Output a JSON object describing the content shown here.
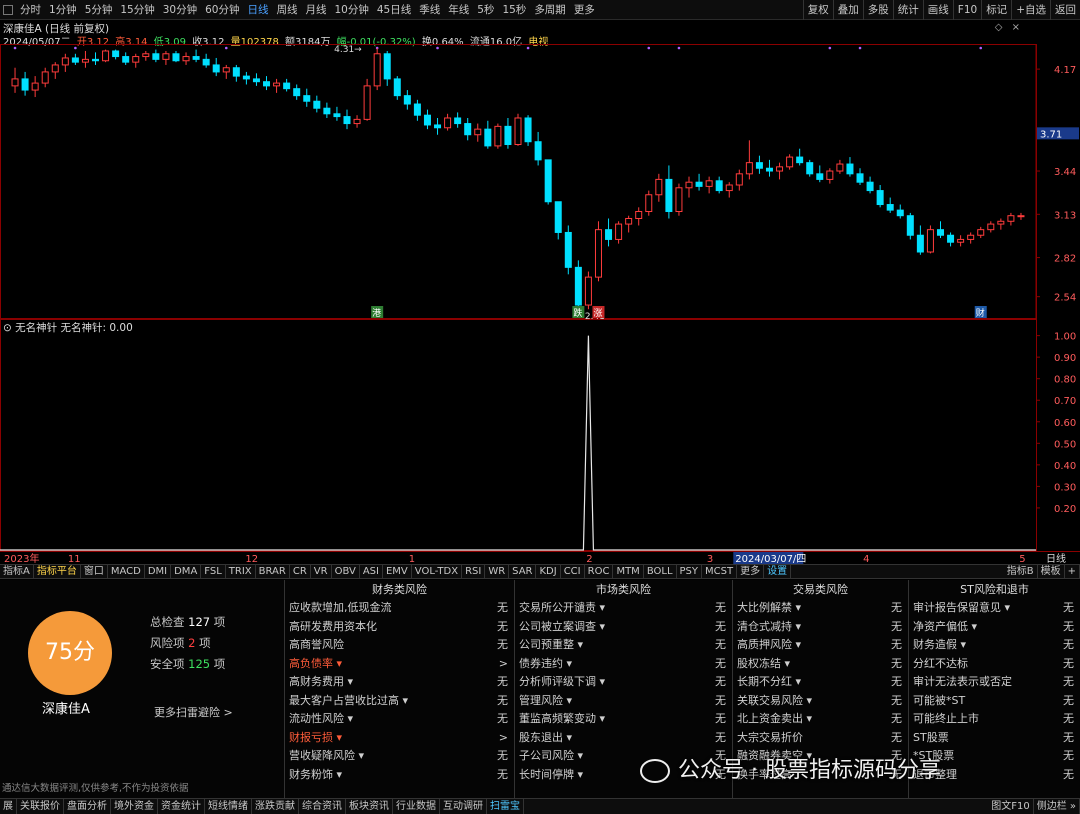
{
  "toolbar": {
    "left": [
      "分时",
      "1分钟",
      "5分钟",
      "15分钟",
      "30分钟",
      "60分钟",
      "日线",
      "周线",
      "月线",
      "10分钟",
      "45日线",
      "季线",
      "年线",
      "5秒",
      "15秒",
      "多周期",
      "更多"
    ],
    "selected": "日线",
    "right": [
      "复权",
      "叠加",
      "多股",
      "统计",
      "画线",
      "F10",
      "标记",
      "+自选",
      "返回"
    ]
  },
  "header": {
    "title": "深康佳A (日线 前复权)",
    "date": "2024/05/07二",
    "open": "开3.12",
    "high": "高3.14",
    "low": "低3.09",
    "close": "收3.12",
    "volume": "量102378",
    "amount": "额3184万",
    "change": "幅-0.01(-0.32%)",
    "turnover": "换0.64%",
    "float": "流通16.0亿",
    "tv": "电视",
    "high_mark": "4.31",
    "low_mark": "2.41"
  },
  "chart_data": [
    {
      "type": "candlestick",
      "y_ticks": [
        4.17,
        3.71,
        3.44,
        3.13,
        2.82,
        2.54
      ],
      "current_price": "3.71",
      "ylim": [
        2.38,
        4.35
      ],
      "candles": [
        [
          4.05,
          4.18,
          4.0,
          4.1
        ],
        [
          4.1,
          4.15,
          3.98,
          4.02
        ],
        [
          4.02,
          4.12,
          3.97,
          4.07
        ],
        [
          4.07,
          4.18,
          4.04,
          4.15
        ],
        [
          4.15,
          4.22,
          4.1,
          4.2
        ],
        [
          4.2,
          4.28,
          4.15,
          4.25
        ],
        [
          4.25,
          4.28,
          4.2,
          4.22
        ],
        [
          4.22,
          4.3,
          4.18,
          4.24
        ],
        [
          4.24,
          4.29,
          4.2,
          4.23
        ],
        [
          4.23,
          4.31,
          4.22,
          4.3
        ],
        [
          4.3,
          4.31,
          4.24,
          4.26
        ],
        [
          4.26,
          4.29,
          4.2,
          4.22
        ],
        [
          4.22,
          4.28,
          4.18,
          4.26
        ],
        [
          4.26,
          4.3,
          4.23,
          4.28
        ],
        [
          4.28,
          4.31,
          4.22,
          4.24
        ],
        [
          4.24,
          4.3,
          4.2,
          4.28
        ],
        [
          4.28,
          4.3,
          4.22,
          4.23
        ],
        [
          4.23,
          4.29,
          4.2,
          4.26
        ],
        [
          4.26,
          4.31,
          4.22,
          4.24
        ],
        [
          4.24,
          4.28,
          4.18,
          4.2
        ],
        [
          4.2,
          4.25,
          4.12,
          4.15
        ],
        [
          4.15,
          4.2,
          4.1,
          4.18
        ],
        [
          4.18,
          4.2,
          4.08,
          4.12
        ],
        [
          4.12,
          4.15,
          4.06,
          4.1
        ],
        [
          4.1,
          4.14,
          4.05,
          4.08
        ],
        [
          4.08,
          4.12,
          4.02,
          4.05
        ],
        [
          4.05,
          4.1,
          4.0,
          4.07
        ],
        [
          4.07,
          4.1,
          4.01,
          4.03
        ],
        [
          4.03,
          4.06,
          3.95,
          3.98
        ],
        [
          3.98,
          4.03,
          3.9,
          3.94
        ],
        [
          3.94,
          3.98,
          3.86,
          3.89
        ],
        [
          3.89,
          3.93,
          3.82,
          3.85
        ],
        [
          3.85,
          3.9,
          3.8,
          3.83
        ],
        [
          3.83,
          3.88,
          3.74,
          3.78
        ],
        [
          3.78,
          3.84,
          3.75,
          3.81
        ],
        [
          3.81,
          4.1,
          3.8,
          4.05
        ],
        [
          4.05,
          4.32,
          4.02,
          4.28
        ],
        [
          4.28,
          4.3,
          4.05,
          4.1
        ],
        [
          4.1,
          4.12,
          3.95,
          3.98
        ],
        [
          3.98,
          4.02,
          3.88,
          3.92
        ],
        [
          3.92,
          3.95,
          3.8,
          3.84
        ],
        [
          3.84,
          3.88,
          3.74,
          3.77
        ],
        [
          3.77,
          3.82,
          3.7,
          3.75
        ],
        [
          3.75,
          3.85,
          3.73,
          3.82
        ],
        [
          3.82,
          3.86,
          3.75,
          3.78
        ],
        [
          3.78,
          3.82,
          3.66,
          3.7
        ],
        [
          3.7,
          3.78,
          3.65,
          3.74
        ],
        [
          3.74,
          3.8,
          3.6,
          3.62
        ],
        [
          3.62,
          3.78,
          3.6,
          3.76
        ],
        [
          3.76,
          3.82,
          3.6,
          3.63
        ],
        [
          3.63,
          3.85,
          3.62,
          3.82
        ],
        [
          3.82,
          3.84,
          3.62,
          3.65
        ],
        [
          3.65,
          3.72,
          3.48,
          3.52
        ],
        [
          3.52,
          3.42,
          3.2,
          3.22
        ],
        [
          3.22,
          3.15,
          2.95,
          3.0
        ],
        [
          3.0,
          3.05,
          2.7,
          2.75
        ],
        [
          2.75,
          2.8,
          2.41,
          2.48
        ],
        [
          2.48,
          2.72,
          2.45,
          2.68
        ],
        [
          2.68,
          3.08,
          2.65,
          3.02
        ],
        [
          3.02,
          3.1,
          2.9,
          2.95
        ],
        [
          2.95,
          3.08,
          2.92,
          3.06
        ],
        [
          3.06,
          3.12,
          3.0,
          3.1
        ],
        [
          3.1,
          3.18,
          3.05,
          3.15
        ],
        [
          3.15,
          3.3,
          3.12,
          3.27
        ],
        [
          3.27,
          3.42,
          3.22,
          3.38
        ],
        [
          3.38,
          3.48,
          3.1,
          3.15
        ],
        [
          3.15,
          3.35,
          3.12,
          3.32
        ],
        [
          3.32,
          3.4,
          3.25,
          3.36
        ],
        [
          3.36,
          3.42,
          3.3,
          3.33
        ],
        [
          3.33,
          3.4,
          3.28,
          3.37
        ],
        [
          3.37,
          3.4,
          3.28,
          3.3
        ],
        [
          3.3,
          3.36,
          3.25,
          3.34
        ],
        [
          3.34,
          3.45,
          3.3,
          3.42
        ],
        [
          3.42,
          3.66,
          3.38,
          3.5
        ],
        [
          3.5,
          3.55,
          3.42,
          3.46
        ],
        [
          3.46,
          3.52,
          3.4,
          3.44
        ],
        [
          3.44,
          3.5,
          3.38,
          3.47
        ],
        [
          3.47,
          3.56,
          3.45,
          3.54
        ],
        [
          3.54,
          3.6,
          3.48,
          3.5
        ],
        [
          3.5,
          3.52,
          3.4,
          3.42
        ],
        [
          3.42,
          3.48,
          3.36,
          3.38
        ],
        [
          3.38,
          3.46,
          3.35,
          3.44
        ],
        [
          3.44,
          3.52,
          3.42,
          3.49
        ],
        [
          3.49,
          3.54,
          3.4,
          3.42
        ],
        [
          3.42,
          3.46,
          3.34,
          3.36
        ],
        [
          3.36,
          3.4,
          3.28,
          3.3
        ],
        [
          3.3,
          3.34,
          3.18,
          3.2
        ],
        [
          3.2,
          3.25,
          3.14,
          3.16
        ],
        [
          3.16,
          3.2,
          3.1,
          3.12
        ],
        [
          3.12,
          3.14,
          2.95,
          2.98
        ],
        [
          2.98,
          3.05,
          2.84,
          2.86
        ],
        [
          2.86,
          3.05,
          2.85,
          3.02
        ],
        [
          3.02,
          3.08,
          2.96,
          2.98
        ],
        [
          2.98,
          3.0,
          2.9,
          2.93
        ],
        [
          2.93,
          2.98,
          2.9,
          2.95
        ],
        [
          2.95,
          3.0,
          2.92,
          2.98
        ],
        [
          2.98,
          3.04,
          2.96,
          3.02
        ],
        [
          3.02,
          3.08,
          3.0,
          3.06
        ],
        [
          3.06,
          3.1,
          3.02,
          3.08
        ],
        [
          3.08,
          3.14,
          3.05,
          3.12
        ],
        [
          3.12,
          3.14,
          3.09,
          3.12
        ]
      ],
      "event_labels": [
        {
          "text": "港",
          "index": 36,
          "color": "#2e7d32"
        },
        {
          "text": "跌",
          "index": 56,
          "color": "#2e7d32"
        },
        {
          "text": "涨",
          "index": 58,
          "color": "#c62828"
        },
        {
          "text": "财",
          "index": 96,
          "color": "#1e5aa8"
        }
      ]
    },
    {
      "type": "line",
      "title": "无名神针  无名神针: 0.00",
      "y_ticks": [
        1.0,
        0.9,
        0.8,
        0.7,
        0.6,
        0.5,
        0.4,
        0.3,
        0.2
      ],
      "ylim": [
        0,
        1.04
      ],
      "spike_index": 57,
      "values_note": "zero everywhere except a single 1.00 spike"
    }
  ],
  "axis": {
    "labels": [
      {
        "text": "2023年",
        "i": 0
      },
      {
        "text": "11",
        "i": 9
      },
      {
        "text": "12",
        "i": 34
      },
      {
        "text": "1",
        "i": 57
      },
      {
        "text": "2",
        "i": 82
      },
      {
        "text": "3",
        "i": 99
      },
      {
        "text": "2024/03/07/四",
        "i": 103
      },
      {
        "text": "4",
        "i": 121
      },
      {
        "text": "5",
        "i": 143
      }
    ],
    "right": "日线"
  },
  "indicator_tabs": [
    "指标A",
    "指标平台",
    "窗口",
    "MACD",
    "DMI",
    "DMA",
    "FSL",
    "TRIX",
    "BRAR",
    "CR",
    "VR",
    "OBV",
    "ASI",
    "EMV",
    "VOL-TDX",
    "RSI",
    "WR",
    "SAR",
    "KDJ",
    "CCI",
    "ROC",
    "MTM",
    "BOLL",
    "PSY",
    "MCST",
    "更多",
    "设置"
  ],
  "indicator_tabs_right": [
    "指标B",
    "模板",
    "+"
  ],
  "risk": {
    "score": "75分",
    "total_label": "总检查",
    "total": "127",
    "risk_label": "风险项",
    "risk": "2",
    "safe_label": "安全项",
    "safe": "125",
    "unit": "项",
    "stock": "深康佳A",
    "more": "更多扫雷避险 >",
    "disclaimer": "通达信大数据评测,仅供参考,不作为投资依据",
    "columns": [
      {
        "title": "财务类风险",
        "items": [
          [
            "应收款增加,低现金流",
            "无"
          ],
          [
            "高研发费用资本化",
            "无"
          ],
          [
            "高商誉风险",
            "无"
          ],
          [
            "高负债率 ▾",
            ">"
          ],
          [
            "高财务费用 ▾",
            "无"
          ],
          [
            "最大客户占营收比过高 ▾",
            "无"
          ],
          [
            "流动性风险 ▾",
            "无"
          ],
          [
            "财报亏损 ▾",
            ">"
          ],
          [
            "营收疑降风险 ▾",
            "无"
          ],
          [
            "财务粉饰 ▾",
            "无"
          ]
        ]
      },
      {
        "title": "市场类风险",
        "items": [
          [
            "交易所公开谴责 ▾",
            "无"
          ],
          [
            "公司被立案调查 ▾",
            "无"
          ],
          [
            "公司预重整 ▾",
            "无"
          ],
          [
            "债券违约 ▾",
            "无"
          ],
          [
            "分析师评级下调 ▾",
            "无"
          ],
          [
            "管理风险 ▾",
            "无"
          ],
          [
            "董监高频繁变动 ▾",
            "无"
          ],
          [
            "股东退出 ▾",
            "无"
          ],
          [
            "子公司风险 ▾",
            "无"
          ],
          [
            "长时间停牌 ▾",
            "无"
          ]
        ]
      },
      {
        "title": "交易类风险",
        "items": [
          [
            "大比例解禁 ▾",
            "无"
          ],
          [
            "清仓式减持 ▾",
            "无"
          ],
          [
            "高质押风险 ▾",
            "无"
          ],
          [
            "股权冻结 ▾",
            "无"
          ],
          [
            "长期不分红 ▾",
            "无"
          ],
          [
            "关联交易风险 ▾",
            "无"
          ],
          [
            "北上资金卖出 ▾",
            "无"
          ],
          [
            "大宗交易折价",
            "无"
          ],
          [
            "融资融券卖空 ▾",
            "无"
          ],
          [
            "换手率过高",
            "无"
          ]
        ]
      },
      {
        "title": "ST风险和退市",
        "items": [
          [
            "审计报告保留意见 ▾",
            "无"
          ],
          [
            "净资产偏低 ▾",
            "无"
          ],
          [
            "财务造假 ▾",
            "无"
          ],
          [
            "分红不达标",
            "无"
          ],
          [
            "审计无法表示或否定",
            "无"
          ],
          [
            "可能被*ST",
            "无"
          ],
          [
            "可能终止上市",
            "无"
          ],
          [
            "ST股票",
            "无"
          ],
          [
            "*ST股票",
            "无"
          ],
          [
            "退市整理",
            "无"
          ]
        ]
      }
    ]
  },
  "watermark": "公众号 · 股票指标源码分享",
  "status": [
    "展",
    "关联报价",
    "盘面分析",
    "境外资金",
    "资金统计",
    "短线情绪",
    "涨跌贡献",
    "综合资讯",
    "板块资讯",
    "行业数据",
    "互动调研",
    "扫雷宝"
  ],
  "status_right": [
    "图文F10",
    "侧边栏 »"
  ],
  "colors": {
    "up": "#ff3c3c",
    "down": "#00e0ff",
    "purple": "#b060ff",
    "orange": "#f59a3a"
  }
}
